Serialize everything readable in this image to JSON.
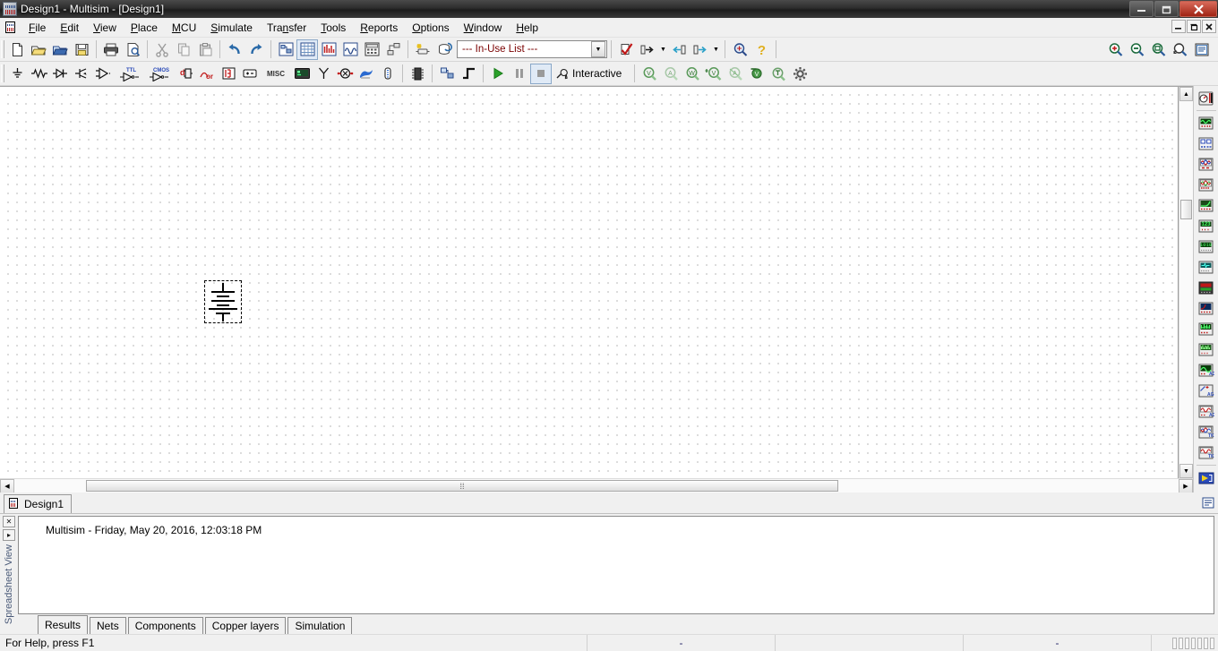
{
  "window": {
    "title": "Design1 - Multisim - [Design1]",
    "minimize": "—",
    "maximize": "❐",
    "close": "✕",
    "mdi_minimize": "_",
    "mdi_restore": "❐",
    "mdi_close": "✕"
  },
  "menu": [
    {
      "label": "File",
      "mnemonic": "F"
    },
    {
      "label": "Edit",
      "mnemonic": "E"
    },
    {
      "label": "View",
      "mnemonic": "V"
    },
    {
      "label": "Place",
      "mnemonic": "P"
    },
    {
      "label": "MCU",
      "mnemonic": "M"
    },
    {
      "label": "Simulate",
      "mnemonic": "S"
    },
    {
      "label": "Transfer",
      "mnemonic": "n"
    },
    {
      "label": "Tools",
      "mnemonic": "T"
    },
    {
      "label": "Reports",
      "mnemonic": "R"
    },
    {
      "label": "Options",
      "mnemonic": "O"
    },
    {
      "label": "Window",
      "mnemonic": "W"
    },
    {
      "label": "Help",
      "mnemonic": "H"
    }
  ],
  "standard_toolbar": [
    {
      "name": "new-icon",
      "title": "New"
    },
    {
      "name": "open-icon",
      "title": "Open"
    },
    {
      "name": "open-design-icon",
      "title": "Open design"
    },
    {
      "name": "save-icon",
      "title": "Save"
    },
    {
      "name": "print-icon",
      "title": "Print"
    },
    {
      "name": "print-preview-icon",
      "title": "Print preview"
    },
    {
      "name": "cut-icon",
      "title": "Cut"
    },
    {
      "name": "copy-icon",
      "title": "Copy"
    },
    {
      "name": "paste-icon",
      "title": "Paste"
    },
    {
      "name": "undo-icon",
      "title": "Undo"
    },
    {
      "name": "redo-icon",
      "title": "Redo"
    }
  ],
  "view_toolbar": [
    {
      "name": "design-toolbox-icon",
      "title": "Toggle design toolbox"
    },
    {
      "name": "spreadsheet-view-icon",
      "title": "Toggle spreadsheet view"
    },
    {
      "name": "sprite-view-icon",
      "title": "Toggle SPICE netlist viewer"
    },
    {
      "name": "grapher-icon",
      "title": "Grapher"
    },
    {
      "name": "postprocessor-icon",
      "title": "Postprocessor"
    },
    {
      "name": "hierarchy-icon",
      "title": "Parent sheet"
    }
  ],
  "inuse": {
    "label": "--- In-Use List ---",
    "caret": "▼",
    "new-component-icon": "New component",
    "database-icon": "Database manager"
  },
  "check_toolbar": [
    {
      "name": "erc-icon",
      "title": "Electrical rules check"
    },
    {
      "name": "transfer-to-ultiboard-icon",
      "title": "Transfer to Ultiboard"
    },
    {
      "name": "backannotate-icon",
      "title": "Backannotate from Ultiboard"
    },
    {
      "name": "forward-annotate-icon",
      "title": "Forward annotate"
    }
  ],
  "help_toolbar": [
    {
      "name": "find-icon",
      "title": "Find"
    },
    {
      "name": "help-icon",
      "title": "Help"
    }
  ],
  "zoom_toolbar": [
    {
      "name": "zoom-in-icon",
      "title": "Zoom in"
    },
    {
      "name": "zoom-out-icon",
      "title": "Zoom out"
    },
    {
      "name": "zoom-area-icon",
      "title": "Zoom area"
    },
    {
      "name": "zoom-fit-icon",
      "title": "Zoom fit to page"
    },
    {
      "name": "zoom-selection-icon",
      "title": "Zoom selection"
    }
  ],
  "components_toolbar": [
    {
      "name": "place-source-icon",
      "title": "Place source"
    },
    {
      "name": "place-basic-icon",
      "title": "Place basic"
    },
    {
      "name": "place-diode-icon",
      "title": "Place diode"
    },
    {
      "name": "place-transistor-icon",
      "title": "Place transistor"
    },
    {
      "name": "place-analog-icon",
      "title": "Place analog"
    },
    {
      "name": "place-ttl-icon",
      "title": "Place TTL"
    },
    {
      "name": "place-cmos-icon",
      "title": "Place CMOS"
    },
    {
      "name": "place-misc-digital-icon",
      "title": "Place misc digital"
    },
    {
      "name": "place-mixed-icon",
      "title": "Place mixed"
    },
    {
      "name": "place-indicator-icon",
      "title": "Place indicator"
    },
    {
      "name": "place-power-icon",
      "title": "Place power component"
    },
    {
      "name": "place-misc-icon",
      "title": "Place misc",
      "text": "MISC"
    },
    {
      "name": "place-advanced-peripherals-icon",
      "title": "Place advanced peripherals"
    },
    {
      "name": "place-rf-icon",
      "title": "Place RF"
    },
    {
      "name": "place-electromechanical-icon",
      "title": "Place electromechanical"
    },
    {
      "name": "place-ni-components-icon",
      "title": "Place NI components"
    },
    {
      "name": "place-connectors-icon",
      "title": "Place connectors"
    },
    {
      "name": "place-mcu-icon",
      "title": "Place MCU"
    },
    {
      "name": "place-hierarchical-block-icon",
      "title": "Place hierarchical block"
    },
    {
      "name": "place-bus-icon",
      "title": "Place bus"
    }
  ],
  "simulation": {
    "run_icon": "run-icon",
    "pause_icon": "pause-icon",
    "stop_icon": "stop-icon",
    "mode_label": "Interactive",
    "mode_icon": "wrench-icon"
  },
  "probe_toolbar": [
    {
      "name": "voltage-probe-icon",
      "title": "Voltage probe",
      "glyph": "V"
    },
    {
      "name": "current-probe-icon",
      "title": "Current probe",
      "glyph": "A"
    },
    {
      "name": "power-probe-icon",
      "title": "Power probe",
      "glyph": "W"
    },
    {
      "name": "differential-voltage-probe-icon",
      "title": "Differential voltage probe",
      "glyph": "V"
    },
    {
      "name": "voltage-and-current-probe-icon",
      "title": "Voltage and current probe",
      "glyph": "A"
    },
    {
      "name": "referenced-voltage-probe-icon",
      "title": "Referenced voltage probe",
      "glyph": "V"
    },
    {
      "name": "digital-probe-icon",
      "title": "Digital probe",
      "glyph": "⏚"
    },
    {
      "name": "probe-settings-icon",
      "title": "Probe settings",
      "glyph": "gear"
    }
  ],
  "instruments": [
    {
      "name": "multimeter-icon",
      "title": "Multimeter"
    },
    {
      "name": "function-generator-icon",
      "title": "Function generator"
    },
    {
      "name": "wattmeter-icon",
      "title": "Wattmeter"
    },
    {
      "name": "oscilloscope-icon",
      "title": "Oscilloscope"
    },
    {
      "name": "four-channel-oscilloscope-icon",
      "title": "4 channel oscilloscope"
    },
    {
      "name": "bode-plotter-icon",
      "title": "Bode plotter"
    },
    {
      "name": "frequency-counter-icon",
      "title": "Frequency counter"
    },
    {
      "name": "word-generator-icon",
      "title": "Word generator"
    },
    {
      "name": "logic-converter-icon",
      "title": "Logic converter"
    },
    {
      "name": "logic-analyzer-icon",
      "title": "Logic analyzer"
    },
    {
      "name": "iv-analyzer-icon",
      "title": "IV analyzer"
    },
    {
      "name": "distortion-analyzer-icon",
      "title": "Distortion analyzer"
    },
    {
      "name": "spectrum-analyzer-icon",
      "title": "Spectrum analyzer"
    },
    {
      "name": "network-analyzer-icon",
      "title": "Network analyzer"
    },
    {
      "name": "agilent-function-generator-icon",
      "title": "Agilent function generator"
    },
    {
      "name": "agilent-multimeter-icon",
      "title": "Agilent multimeter"
    },
    {
      "name": "agilent-oscilloscope-icon",
      "title": "Agilent oscilloscope"
    },
    {
      "name": "tektronix-oscilloscope-icon",
      "title": "Tektronix oscilloscope"
    },
    {
      "name": "labview-instruments-icon",
      "title": "LabVIEW instruments"
    },
    {
      "name": "labview-instruments-caret-icon",
      "title": "More LabVIEW instruments"
    },
    {
      "name": "current-clamp-icon",
      "title": "Current probe / clamp"
    },
    {
      "name": "more-instruments-icon",
      "title": "More instruments"
    }
  ],
  "canvas": {
    "component": "battery-symbol",
    "selected": true
  },
  "design_tab": {
    "label": "Design1",
    "icon": "design-file-icon",
    "right_icon": "tab-overflow-icon",
    "right_caret": "▼"
  },
  "spreadsheet": {
    "panel_label": "Spreadsheet View",
    "close_button": "✕",
    "expand_button": "▸",
    "log_line": "Multisim  -  Friday, May 20, 2016, 12:03:18 PM",
    "tabs": [
      {
        "label": "Results",
        "active": true
      },
      {
        "label": "Nets",
        "active": false
      },
      {
        "label": "Components",
        "active": false
      },
      {
        "label": "Copper layers",
        "active": false
      },
      {
        "label": "Simulation",
        "active": false
      }
    ]
  },
  "statusbar": {
    "help_text": "For Help, press F1",
    "cell_1": "-",
    "cell_2": "",
    "cell_3": "-"
  },
  "colors": {
    "accent_blue": "#2a4a8a",
    "accent_red": "#b02020",
    "inuse_text": "#7a0000",
    "run_green": "#2aa02a",
    "probe_green": "#4a8a4a",
    "titlebar": "#2d2d2d",
    "chrome": "#f0f0f0"
  }
}
